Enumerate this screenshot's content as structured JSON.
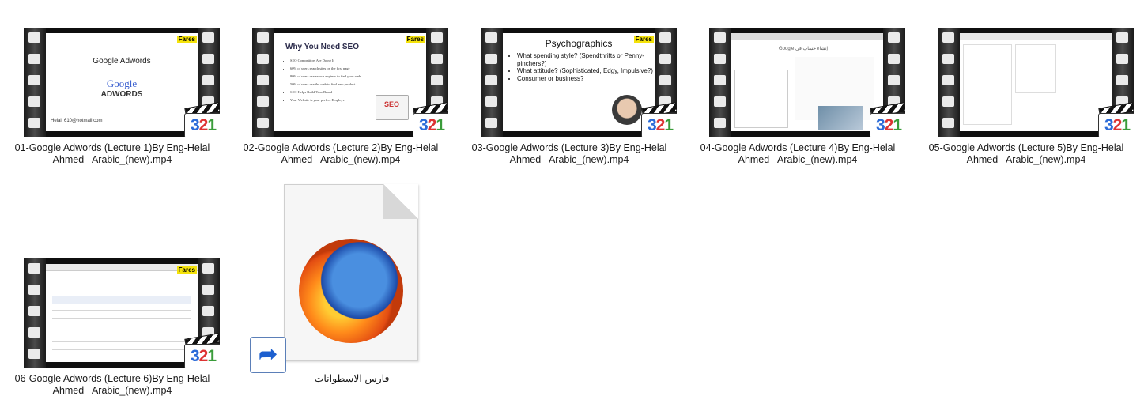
{
  "files": [
    {
      "label": "01-Google Adwords (Lecture 1)By Eng-Helal\nAhmed   Arabic_(new).mp4",
      "kind": "video"
    },
    {
      "label": "02-Google Adwords (Lecture 2)By Eng-Helal\nAhmed   Arabic_(new).mp4",
      "kind": "video"
    },
    {
      "label": "03-Google Adwords (Lecture 3)By Eng-Helal\nAhmed   Arabic_(new).mp4",
      "kind": "video"
    },
    {
      "label": "04-Google Adwords (Lecture 4)By Eng-Helal\nAhmed   Arabic_(new).mp4",
      "kind": "video"
    },
    {
      "label": "05-Google Adwords (Lecture 5)By Eng-Helal\nAhmed   Arabic_(new).mp4",
      "kind": "video"
    },
    {
      "label": "06-Google Adwords (Lecture 6)By Eng-Helal\nAhmed   Arabic_(new).mp4",
      "kind": "video"
    },
    {
      "label": "فارس الاسطوانات",
      "kind": "shortcut",
      "icon": "firefox-icon"
    }
  ],
  "thumbs": {
    "badge": [
      "3",
      "2",
      "1"
    ],
    "tag": "Fares",
    "slide1": {
      "title": "Google Adwords",
      "logo": "Google",
      "logo_sub": "ADWORDS",
      "email": "Helal_610@hotmail.com"
    },
    "slide2": {
      "title": "Why You Need SEO",
      "bullets": [
        "SEO Competitors Are Doing It",
        "60% of users search sites on the first page",
        "80% of users use search engines to find your web",
        "50% of users use the web to find new product",
        "SEO Helps Build Your Brand",
        "Your Website is your perfect Employe"
      ],
      "seo_text": "SEO"
    },
    "slide3": {
      "title": "Psychographics",
      "bullets": [
        "What spending style? (Spendthrifts or Penny-pinchers?)",
        "What attitude? (Sophisticated, Edgy, Impulsive?)",
        "Consumer or business?"
      ]
    },
    "slide4": {
      "title": "Google إنشاء حساب في"
    }
  },
  "colors": {
    "badge_3": "#2b6bd8",
    "badge_2": "#d33",
    "badge_1": "#3a9c3a",
    "shortcut_arrow": "#1c5fcf"
  }
}
